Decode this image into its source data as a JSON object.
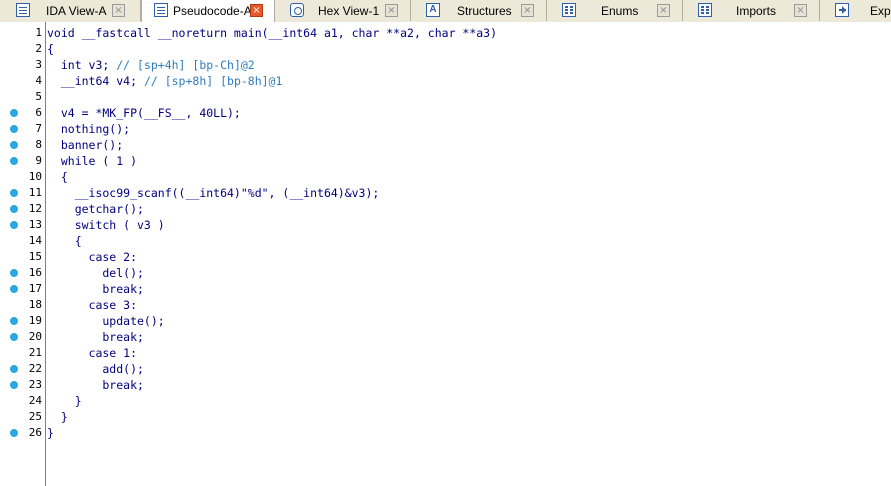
{
  "tabs": [
    {
      "label": "IDA View-A",
      "icon": "ida-view-icon",
      "active": false
    },
    {
      "label": "Pseudocode-A",
      "icon": "pseudocode-icon",
      "active": true
    },
    {
      "label": "Hex View-1",
      "icon": "hex-view-icon",
      "active": false
    },
    {
      "label": "Structures",
      "icon": "structures-icon",
      "active": false
    },
    {
      "label": "Enums",
      "icon": "enums-icon",
      "active": false
    },
    {
      "label": "Imports",
      "icon": "imports-icon",
      "active": false
    },
    {
      "label": "Exp",
      "icon": "exports-icon",
      "active": false
    }
  ],
  "close_glyph": "×",
  "colors": {
    "keyword": "#000080",
    "comment": "#2f7dbd",
    "breakpoint": "#2ca8e0",
    "active_close": "#e8582a"
  },
  "code": [
    {
      "n": "1",
      "bp": false,
      "text": "void __fastcall __noreturn main(__int64 a1, char **a2, char **a3)"
    },
    {
      "n": "2",
      "bp": false,
      "text": "{"
    },
    {
      "n": "3",
      "bp": false,
      "text": "  int v3; ",
      "comment": "// [sp+4h] [bp-Ch]@2"
    },
    {
      "n": "4",
      "bp": false,
      "text": "  __int64 v4; ",
      "comment": "// [sp+8h] [bp-8h]@1"
    },
    {
      "n": "5",
      "bp": false,
      "text": ""
    },
    {
      "n": "6",
      "bp": true,
      "text": "  v4 = *MK_FP(__FS__, 40LL);"
    },
    {
      "n": "7",
      "bp": true,
      "text": "  nothing();"
    },
    {
      "n": "8",
      "bp": true,
      "text": "  banner();"
    },
    {
      "n": "9",
      "bp": true,
      "text": "  while ( 1 )"
    },
    {
      "n": "10",
      "bp": false,
      "text": "  {"
    },
    {
      "n": "11",
      "bp": true,
      "text": "    __isoc99_scanf((__int64)\"%d\", (__int64)&v3);"
    },
    {
      "n": "12",
      "bp": true,
      "text": "    getchar();"
    },
    {
      "n": "13",
      "bp": true,
      "text": "    switch ( v3 )"
    },
    {
      "n": "14",
      "bp": false,
      "text": "    {"
    },
    {
      "n": "15",
      "bp": false,
      "text": "      case 2:"
    },
    {
      "n": "16",
      "bp": true,
      "text": "        del();"
    },
    {
      "n": "17",
      "bp": true,
      "text": "        break;"
    },
    {
      "n": "18",
      "bp": false,
      "text": "      case 3:"
    },
    {
      "n": "19",
      "bp": true,
      "text": "        update();"
    },
    {
      "n": "20",
      "bp": true,
      "text": "        break;"
    },
    {
      "n": "21",
      "bp": false,
      "text": "      case 1:"
    },
    {
      "n": "22",
      "bp": true,
      "text": "        add();"
    },
    {
      "n": "23",
      "bp": true,
      "text": "        break;"
    },
    {
      "n": "24",
      "bp": false,
      "text": "    }"
    },
    {
      "n": "25",
      "bp": false,
      "text": "  }"
    },
    {
      "n": "26",
      "bp": true,
      "text": "}"
    }
  ]
}
